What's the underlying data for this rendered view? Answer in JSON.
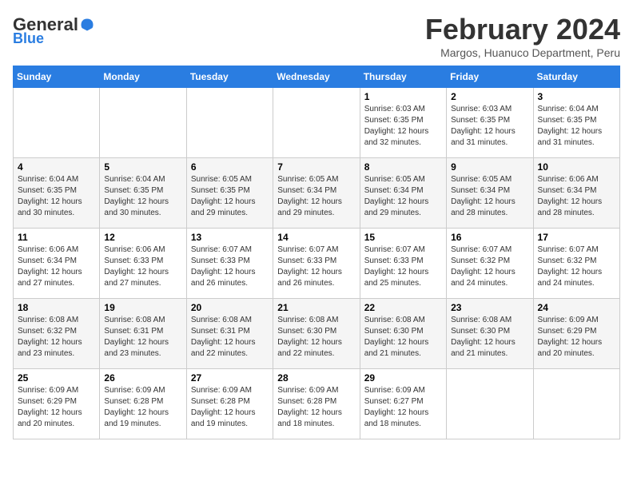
{
  "header": {
    "logo_main": "General",
    "logo_sub": "Blue",
    "month": "February 2024",
    "location": "Margos, Huanuco Department, Peru"
  },
  "days_of_week": [
    "Sunday",
    "Monday",
    "Tuesday",
    "Wednesday",
    "Thursday",
    "Friday",
    "Saturday"
  ],
  "weeks": [
    [
      {
        "day": "",
        "detail": ""
      },
      {
        "day": "",
        "detail": ""
      },
      {
        "day": "",
        "detail": ""
      },
      {
        "day": "",
        "detail": ""
      },
      {
        "day": "1",
        "detail": "Sunrise: 6:03 AM\nSunset: 6:35 PM\nDaylight: 12 hours\nand 32 minutes."
      },
      {
        "day": "2",
        "detail": "Sunrise: 6:03 AM\nSunset: 6:35 PM\nDaylight: 12 hours\nand 31 minutes."
      },
      {
        "day": "3",
        "detail": "Sunrise: 6:04 AM\nSunset: 6:35 PM\nDaylight: 12 hours\nand 31 minutes."
      }
    ],
    [
      {
        "day": "4",
        "detail": "Sunrise: 6:04 AM\nSunset: 6:35 PM\nDaylight: 12 hours\nand 30 minutes."
      },
      {
        "day": "5",
        "detail": "Sunrise: 6:04 AM\nSunset: 6:35 PM\nDaylight: 12 hours\nand 30 minutes."
      },
      {
        "day": "6",
        "detail": "Sunrise: 6:05 AM\nSunset: 6:35 PM\nDaylight: 12 hours\nand 29 minutes."
      },
      {
        "day": "7",
        "detail": "Sunrise: 6:05 AM\nSunset: 6:34 PM\nDaylight: 12 hours\nand 29 minutes."
      },
      {
        "day": "8",
        "detail": "Sunrise: 6:05 AM\nSunset: 6:34 PM\nDaylight: 12 hours\nand 29 minutes."
      },
      {
        "day": "9",
        "detail": "Sunrise: 6:05 AM\nSunset: 6:34 PM\nDaylight: 12 hours\nand 28 minutes."
      },
      {
        "day": "10",
        "detail": "Sunrise: 6:06 AM\nSunset: 6:34 PM\nDaylight: 12 hours\nand 28 minutes."
      }
    ],
    [
      {
        "day": "11",
        "detail": "Sunrise: 6:06 AM\nSunset: 6:34 PM\nDaylight: 12 hours\nand 27 minutes."
      },
      {
        "day": "12",
        "detail": "Sunrise: 6:06 AM\nSunset: 6:33 PM\nDaylight: 12 hours\nand 27 minutes."
      },
      {
        "day": "13",
        "detail": "Sunrise: 6:07 AM\nSunset: 6:33 PM\nDaylight: 12 hours\nand 26 minutes."
      },
      {
        "day": "14",
        "detail": "Sunrise: 6:07 AM\nSunset: 6:33 PM\nDaylight: 12 hours\nand 26 minutes."
      },
      {
        "day": "15",
        "detail": "Sunrise: 6:07 AM\nSunset: 6:33 PM\nDaylight: 12 hours\nand 25 minutes."
      },
      {
        "day": "16",
        "detail": "Sunrise: 6:07 AM\nSunset: 6:32 PM\nDaylight: 12 hours\nand 24 minutes."
      },
      {
        "day": "17",
        "detail": "Sunrise: 6:07 AM\nSunset: 6:32 PM\nDaylight: 12 hours\nand 24 minutes."
      }
    ],
    [
      {
        "day": "18",
        "detail": "Sunrise: 6:08 AM\nSunset: 6:32 PM\nDaylight: 12 hours\nand 23 minutes."
      },
      {
        "day": "19",
        "detail": "Sunrise: 6:08 AM\nSunset: 6:31 PM\nDaylight: 12 hours\nand 23 minutes."
      },
      {
        "day": "20",
        "detail": "Sunrise: 6:08 AM\nSunset: 6:31 PM\nDaylight: 12 hours\nand 22 minutes."
      },
      {
        "day": "21",
        "detail": "Sunrise: 6:08 AM\nSunset: 6:30 PM\nDaylight: 12 hours\nand 22 minutes."
      },
      {
        "day": "22",
        "detail": "Sunrise: 6:08 AM\nSunset: 6:30 PM\nDaylight: 12 hours\nand 21 minutes."
      },
      {
        "day": "23",
        "detail": "Sunrise: 6:08 AM\nSunset: 6:30 PM\nDaylight: 12 hours\nand 21 minutes."
      },
      {
        "day": "24",
        "detail": "Sunrise: 6:09 AM\nSunset: 6:29 PM\nDaylight: 12 hours\nand 20 minutes."
      }
    ],
    [
      {
        "day": "25",
        "detail": "Sunrise: 6:09 AM\nSunset: 6:29 PM\nDaylight: 12 hours\nand 20 minutes."
      },
      {
        "day": "26",
        "detail": "Sunrise: 6:09 AM\nSunset: 6:28 PM\nDaylight: 12 hours\nand 19 minutes."
      },
      {
        "day": "27",
        "detail": "Sunrise: 6:09 AM\nSunset: 6:28 PM\nDaylight: 12 hours\nand 19 minutes."
      },
      {
        "day": "28",
        "detail": "Sunrise: 6:09 AM\nSunset: 6:28 PM\nDaylight: 12 hours\nand 18 minutes."
      },
      {
        "day": "29",
        "detail": "Sunrise: 6:09 AM\nSunset: 6:27 PM\nDaylight: 12 hours\nand 18 minutes."
      },
      {
        "day": "",
        "detail": ""
      },
      {
        "day": "",
        "detail": ""
      }
    ]
  ]
}
